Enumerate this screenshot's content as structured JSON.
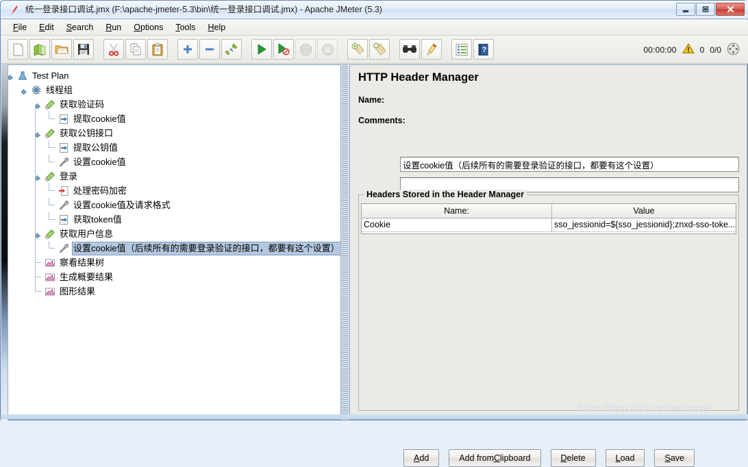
{
  "window": {
    "title": "统一登录接口调试.jmx (F:\\apache-jmeter-5.3\\bin\\统一登录接口调试.jmx) - Apache JMeter (5.3)",
    "app_icon": "jmeter-feather-icon",
    "controls": {
      "minimize": "minimize-icon",
      "maximize": "maximize-icon",
      "close": "close-icon"
    }
  },
  "menubar": {
    "items": [
      {
        "label": "File",
        "mnemonic": "F"
      },
      {
        "label": "Edit",
        "mnemonic": "E"
      },
      {
        "label": "Search",
        "mnemonic": "S"
      },
      {
        "label": "Run",
        "mnemonic": "R"
      },
      {
        "label": "Options",
        "mnemonic": "O"
      },
      {
        "label": "Tools",
        "mnemonic": "T"
      },
      {
        "label": "Help",
        "mnemonic": "H"
      }
    ]
  },
  "toolbar": {
    "buttons": [
      {
        "name": "new-icon",
        "enabled": true
      },
      {
        "name": "templates-icon",
        "enabled": true
      },
      {
        "name": "open-icon",
        "enabled": true
      },
      {
        "name": "save-icon",
        "enabled": true
      },
      {
        "name": "cut-icon",
        "enabled": true
      },
      {
        "name": "copy-icon",
        "enabled": true
      },
      {
        "name": "paste-icon",
        "enabled": true
      },
      {
        "name": "expand-all-icon",
        "enabled": true
      },
      {
        "name": "collapse-all-icon",
        "enabled": true
      },
      {
        "name": "toggle-icon",
        "enabled": true
      },
      {
        "name": "start-icon",
        "enabled": true
      },
      {
        "name": "start-no-pauses-icon",
        "enabled": true
      },
      {
        "name": "stop-icon",
        "enabled": false
      },
      {
        "name": "shutdown-icon",
        "enabled": false
      },
      {
        "name": "clear-icon",
        "enabled": true
      },
      {
        "name": "clear-all-icon",
        "enabled": true
      },
      {
        "name": "search-icon",
        "enabled": true
      },
      {
        "name": "reset-search-icon",
        "enabled": true
      },
      {
        "name": "function-helper-icon",
        "enabled": true
      },
      {
        "name": "help-icon",
        "enabled": true
      }
    ],
    "status": {
      "timer": "00:00:00",
      "warning_icon": "warning-triangle-icon",
      "warning_count": "0",
      "threads": "0/0",
      "remote_icon": "expand-remote-icon"
    }
  },
  "tree": {
    "nodes": [
      {
        "label": "Test Plan",
        "depth": 0,
        "icon": "test-plan-icon",
        "expander": true,
        "selected": false
      },
      {
        "label": "线程组",
        "depth": 1,
        "icon": "thread-group-icon",
        "expander": true,
        "selected": false
      },
      {
        "label": "获取验证码",
        "depth": 2,
        "icon": "http-request-icon",
        "expander": true,
        "selected": false
      },
      {
        "label": "提取cookie值",
        "depth": 3,
        "icon": "post-processor-icon",
        "expander": false,
        "selected": false
      },
      {
        "label": "获取公钥接口",
        "depth": 2,
        "icon": "http-request-icon",
        "expander": true,
        "selected": false
      },
      {
        "label": "提取公钥值",
        "depth": 3,
        "icon": "post-processor-icon",
        "expander": false,
        "selected": false
      },
      {
        "label": "设置cookie值",
        "depth": 3,
        "icon": "header-manager-icon",
        "expander": false,
        "selected": false
      },
      {
        "label": "登录",
        "depth": 2,
        "icon": "http-request-icon",
        "expander": true,
        "selected": false
      },
      {
        "label": "处理密码加密",
        "depth": 3,
        "icon": "pre-processor-icon",
        "expander": false,
        "selected": false
      },
      {
        "label": "设置cookie值及请求格式",
        "depth": 3,
        "icon": "header-manager-icon",
        "expander": false,
        "selected": false
      },
      {
        "label": "获取token值",
        "depth": 3,
        "icon": "post-processor-icon",
        "expander": false,
        "selected": false
      },
      {
        "label": "获取用户信息",
        "depth": 2,
        "icon": "http-request-icon",
        "expander": true,
        "selected": false
      },
      {
        "label": "设置cookie值（后续所有的需要登录验证的接口，都要有这个设置）",
        "depth": 3,
        "icon": "header-manager-icon",
        "expander": false,
        "selected": true
      },
      {
        "label": "察看结果树",
        "depth": 2,
        "icon": "listener-icon",
        "expander": false,
        "selected": false
      },
      {
        "label": "生成概要结果",
        "depth": 2,
        "icon": "listener-icon",
        "expander": false,
        "selected": false
      },
      {
        "label": "图形结果",
        "depth": 2,
        "icon": "listener-icon",
        "expander": false,
        "selected": false
      }
    ]
  },
  "panel": {
    "title": "HTTP Header Manager",
    "name_label": "Name:",
    "name_value": "设置cookie值（后续所有的需要登录验证的接口，都要有这个设置）",
    "comments_label": "Comments:",
    "comments_value": "",
    "group_title": "Headers Stored in the Header Manager",
    "table": {
      "columns": [
        "Name:",
        "Value"
      ],
      "rows": [
        [
          "Cookie",
          "sso_jessionid=${sso_jessionid};znxd-sso-toke..."
        ]
      ]
    },
    "buttons": [
      {
        "label": "Add",
        "mnemonic": "A"
      },
      {
        "label": "Add from Clipboard",
        "mnemonic": "C"
      },
      {
        "label": "Delete",
        "mnemonic": "D"
      },
      {
        "label": "Load",
        "mnemonic": "L"
      },
      {
        "label": "Save",
        "mnemonic": "S"
      }
    ]
  },
  "watermark": "https://blog.csdn.net/wohaqiyi",
  "colors": {
    "selection": "#b4c8e0",
    "panel_bg": "#eceae4",
    "tree_bg": "#ffffff",
    "close_button": "#c23f35"
  }
}
